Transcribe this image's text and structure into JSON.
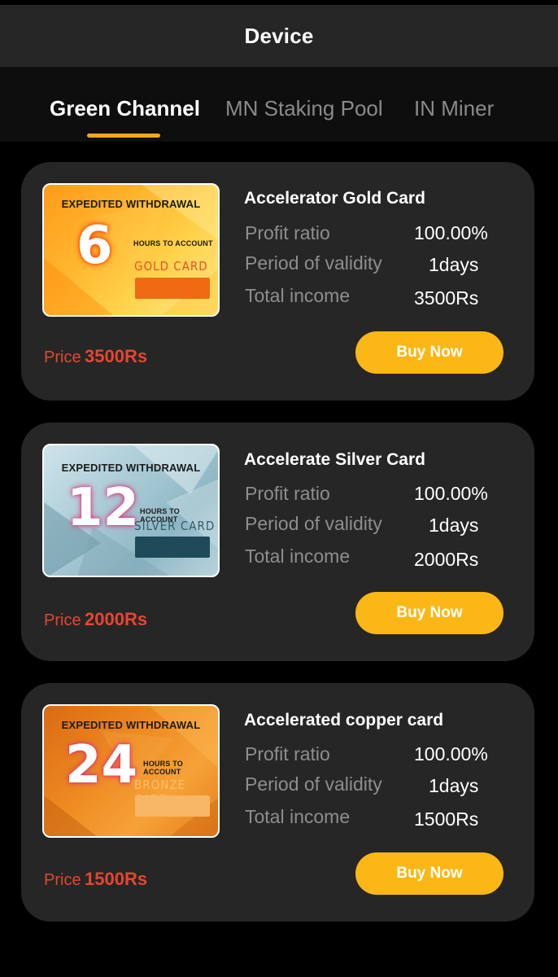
{
  "header": {
    "title": "Device"
  },
  "tabs": [
    {
      "label": "Green Channel"
    },
    {
      "label": "MN Staking Pool"
    },
    {
      "label": "IN Miner"
    }
  ],
  "cards": [
    {
      "title": "Accelerator Gold Card",
      "thumb": {
        "headline": "EXPEDITED WITHDRAWAL",
        "number": "6",
        "hours_text": "HOURS TO ACCOUNT",
        "card_name": "GOLD CARD"
      },
      "rows": [
        {
          "label": "Profit ratio",
          "value": "100.00%"
        },
        {
          "label": "Period of validity",
          "value": "1days"
        },
        {
          "label": "Total income",
          "value": "3500Rs"
        }
      ],
      "price_label": "Price",
      "price_value": "3500Rs",
      "button": "Buy Now"
    },
    {
      "title": "Accelerate Silver Card",
      "thumb": {
        "headline": "EXPEDITED WITHDRAWAL",
        "number": "12",
        "hours_text": "HOURS TO ACCOUNT",
        "card_name": "SILVER CARD"
      },
      "rows": [
        {
          "label": "Profit ratio",
          "value": "100.00%"
        },
        {
          "label": "Period of validity",
          "value": "1days"
        },
        {
          "label": "Total income",
          "value": "2000Rs"
        }
      ],
      "price_label": "Price",
      "price_value": "2000Rs",
      "button": "Buy Now"
    },
    {
      "title": "Accelerated copper card",
      "thumb": {
        "headline": "EXPEDITED WITHDRAWAL",
        "number": "24",
        "hours_text": "HOURS TO ACCOUNT",
        "card_name": "BRONZE CARD"
      },
      "rows": [
        {
          "label": "Profit ratio",
          "value": "100.00%"
        },
        {
          "label": "Period of validity",
          "value": "1days"
        },
        {
          "label": "Total income",
          "value": "1500Rs"
        }
      ],
      "price_label": "Price",
      "price_value": "1500Rs",
      "button": "Buy Now"
    }
  ],
  "colors": {
    "accent": "#f5a623",
    "button": "#fbb715",
    "price": "#e5462f",
    "card_bg": "#262626",
    "page_bg": "#000000"
  }
}
